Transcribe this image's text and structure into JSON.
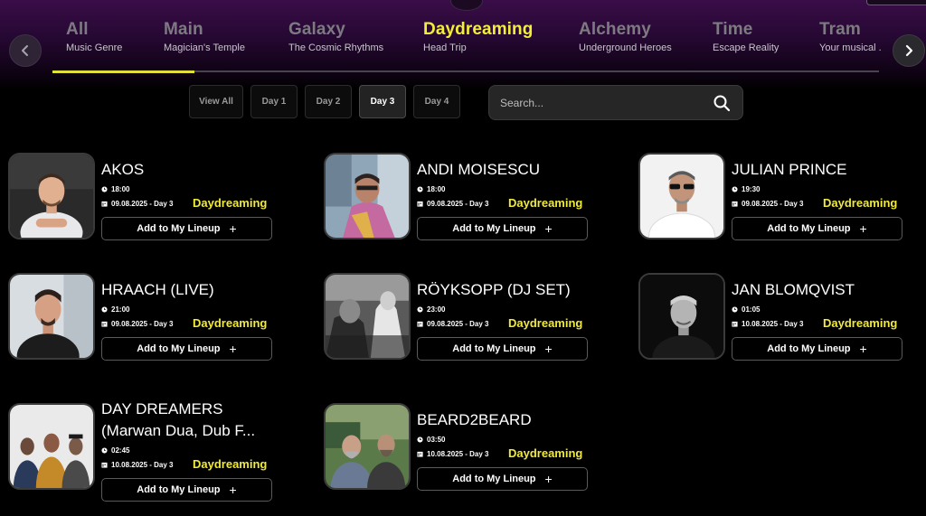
{
  "genres": [
    {
      "name": "All",
      "sub": "Music Genre"
    },
    {
      "name": "Main",
      "sub": "Magician's Temple"
    },
    {
      "name": "Galaxy",
      "sub": "The Cosmic Rhythms"
    },
    {
      "name": "Daydreaming",
      "sub": "Head Trip"
    },
    {
      "name": "Alchemy",
      "sub": "Underground Heroes"
    },
    {
      "name": "Time",
      "sub": "Escape Reality"
    },
    {
      "name": "Tram",
      "sub": "Your musical ."
    }
  ],
  "days": [
    "View All",
    "Day 1",
    "Day 2",
    "Day 3",
    "Day 4"
  ],
  "active_day": "Day 3",
  "active_genre": "Daydreaming",
  "search": {
    "placeholder": "Search..."
  },
  "icons": {
    "prev": "chevron-left-icon",
    "next": "chevron-right-icon",
    "search": "search-icon",
    "time": "clock-icon",
    "date": "calendar-icon",
    "add": "plus-icon"
  },
  "colors": {
    "accent": "#f0ea3c",
    "header_purple": "#3a0d48",
    "background": "#000000"
  },
  "lineup_label": "Add to My Lineup",
  "plus_symbol": "+",
  "artists": [
    {
      "name": "AKOS",
      "time": "18:00",
      "date": "09.08.2025 - Day 3",
      "stage": "Daydreaming"
    },
    {
      "name": "ANDI MOISESCU",
      "time": "18:00",
      "date": "09.08.2025 - Day 3",
      "stage": "Daydreaming"
    },
    {
      "name": "JULIAN PRINCE",
      "time": "19:30",
      "date": "09.08.2025 - Day 3",
      "stage": "Daydreaming"
    },
    {
      "name": "HRAACH (LIVE)",
      "time": "21:00",
      "date": "09.08.2025 - Day 3",
      "stage": "Daydreaming"
    },
    {
      "name": "RÖYKSOPP (DJ SET)",
      "time": "23:00",
      "date": "09.08.2025 - Day 3",
      "stage": "Daydreaming"
    },
    {
      "name": "JAN BLOMQVIST",
      "time": "01:05",
      "date": "10.08.2025 - Day 3",
      "stage": "Daydreaming"
    },
    {
      "name": "DAY DREAMERS",
      "name_line2": "(Marwan Dua, Dub F...",
      "time": "02:45",
      "date": "10.08.2025 - Day 3",
      "stage": "Daydreaming"
    },
    {
      "name": "BEARD2BEARD",
      "time": "03:50",
      "date": "10.08.2025 - Day 3",
      "stage": "Daydreaming"
    }
  ]
}
